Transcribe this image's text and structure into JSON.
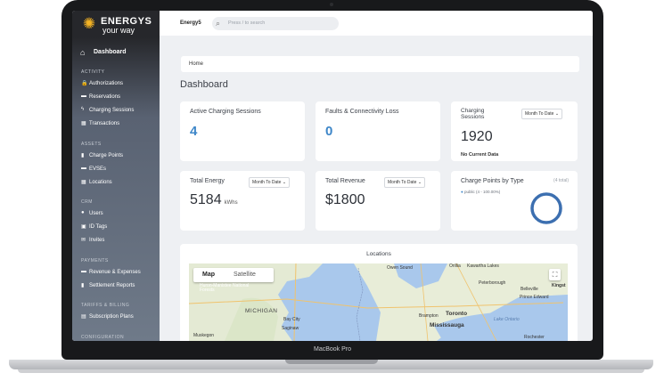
{
  "device_label": "MacBook Pro",
  "sidebar": {
    "logo_line1": "ENERGYS",
    "logo_line2": "your way",
    "active_item": "Dashboard",
    "sections": [
      {
        "title": "ACTIVITY",
        "items": [
          "Authorizations",
          "Reservations",
          "Charging Sessions",
          "Transactions"
        ]
      },
      {
        "title": "ASSETS",
        "items": [
          "Charge Points",
          "EVSEs",
          "Locations"
        ]
      },
      {
        "title": "CRM",
        "items": [
          "Users",
          "ID Tags",
          "Invites"
        ]
      },
      {
        "title": "PAYMENTS",
        "items": [
          "Revenue & Expenses",
          "Settlement Reports"
        ]
      },
      {
        "title": "TARIFFS & BILLING",
        "items": [
          "Subscription Plans"
        ]
      },
      {
        "title": "CONFIGURATION",
        "items": []
      }
    ]
  },
  "topbar": {
    "brand": "Energy5",
    "search_placeholder": "Press / to search"
  },
  "breadcrumb": "Home",
  "page_title": "Dashboard",
  "cards": {
    "active_sessions": {
      "title": "Active Charging Sessions",
      "value": "4"
    },
    "faults": {
      "title": "Faults & Connectivity Loss",
      "value": "0"
    },
    "charging_sessions": {
      "title_line1": "Charging",
      "title_line2": "Sessions",
      "filter": "Month To Date",
      "value": "1920",
      "note": "No Current Data"
    },
    "total_energy": {
      "title": "Total Energy",
      "filter": "Month To Date",
      "value": "5184",
      "unit": "kWhs"
    },
    "total_revenue": {
      "title": "Total Revenue",
      "filter": "Month To Date",
      "value": "$1800"
    },
    "charge_points_type": {
      "title": "Charge Points by Type",
      "total": "(4 total)",
      "legend": "public (4 - 100.00%)",
      "public_share": 1.0
    }
  },
  "map": {
    "title": "Locations",
    "tab_map": "Map",
    "tab_satellite": "Satellite",
    "labels": [
      "Owen Sound",
      "Orillia",
      "Kawartha Lakes",
      "Peterborough",
      "Belleville",
      "Prince Edward",
      "Kingst",
      "Huron-Manistee National Forests",
      "MICHIGAN",
      "Bay City",
      "Saginaw",
      "Brampton",
      "Toronto",
      "Mississauga",
      "Lake Ontario",
      "Muskegon",
      "Rochester"
    ]
  },
  "colors": {
    "accent_blue": "#3d86c8",
    "sun": "#f4b324",
    "water": "#a9c8ec",
    "land": "#e8edd8"
  }
}
